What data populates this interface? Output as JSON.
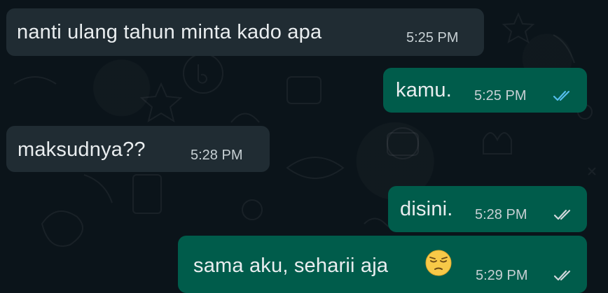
{
  "messages": [
    {
      "direction": "incoming",
      "text": "nanti ulang tahun minta kado apa",
      "time": "5:25 PM"
    },
    {
      "direction": "outgoing",
      "text": "kamu.",
      "time": "5:25 PM",
      "status_icon": "double-check-icon",
      "status_color": "#53bdeb"
    },
    {
      "direction": "incoming",
      "text": "maksudnya??",
      "time": "5:28 PM"
    },
    {
      "direction": "outgoing",
      "text": "disini.",
      "time": "5:28 PM",
      "status_icon": "double-check-icon",
      "status_color": "#d1d7db"
    },
    {
      "direction": "outgoing",
      "text": "sama aku, seharii aja",
      "emoji": "pensive-face-icon",
      "time": "5:29 PM",
      "status_icon": "double-check-icon",
      "status_color": "#d1d7db"
    }
  ],
  "colors": {
    "background": "#0b141a",
    "incoming_bubble": "#202c33",
    "outgoing_bubble": "#005c4b",
    "text": "#e9edef",
    "read_ticks": "#53bdeb"
  }
}
